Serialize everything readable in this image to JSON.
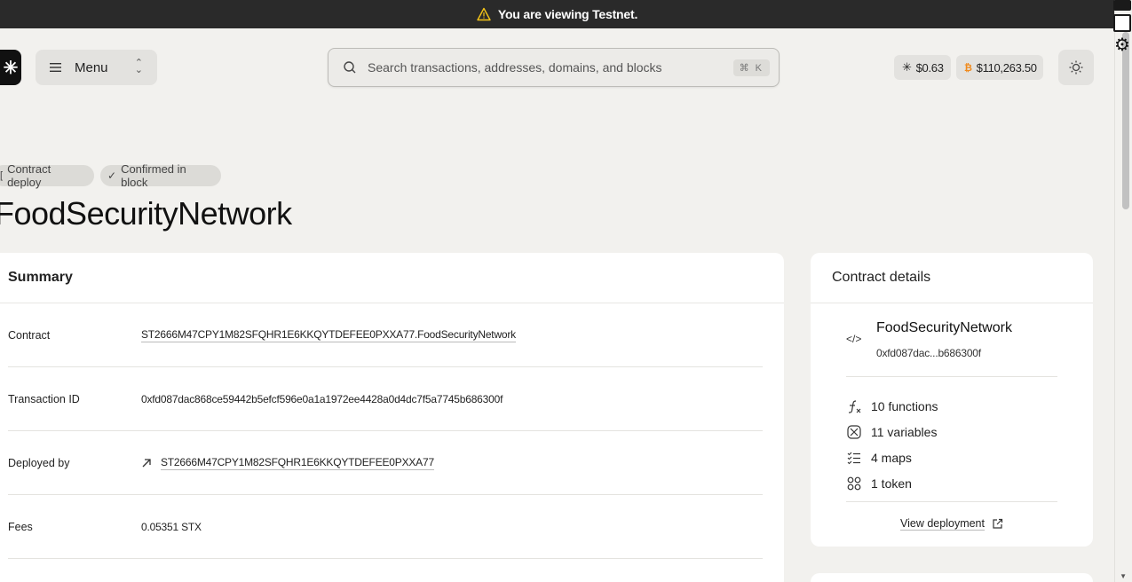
{
  "banner": {
    "text": "You are viewing Testnet."
  },
  "header": {
    "menu_label": "Menu",
    "search_placeholder": "Search transactions, addresses, domains, and blocks",
    "search_shortcut": "⌘ K",
    "stx_price": "$0.63",
    "btc_price": "$110,263.50"
  },
  "tags": {
    "type": "Contract deploy",
    "status": "Confirmed in block"
  },
  "page_title": "FoodSecurityNetwork",
  "summary": {
    "heading": "Summary",
    "rows": [
      {
        "label": "Contract",
        "value": "ST2666M47CPY1M82SFQHR1E6KKQYTDEFEE0PXXA77.FoodSecurityNetwork"
      },
      {
        "label": "Transaction ID",
        "value": "0xfd087dac868ce59442b5efcf596e0a1a1972ee4428a0d4dc7f5a7745b686300f"
      },
      {
        "label": "Deployed by",
        "value": "ST2666M47CPY1M82SFQHR1E6KKQYTDEFEE0PXXA77"
      },
      {
        "label": "Fees",
        "value": "0.05351 STX"
      }
    ]
  },
  "contract_details": {
    "heading": "Contract details",
    "name": "FoodSecurityNetwork",
    "hash": "0xfd087dac...b686300f",
    "stats": [
      "10 functions",
      "11 variables",
      "4 maps",
      "1 token"
    ],
    "view_deployment": "View deployment"
  }
}
